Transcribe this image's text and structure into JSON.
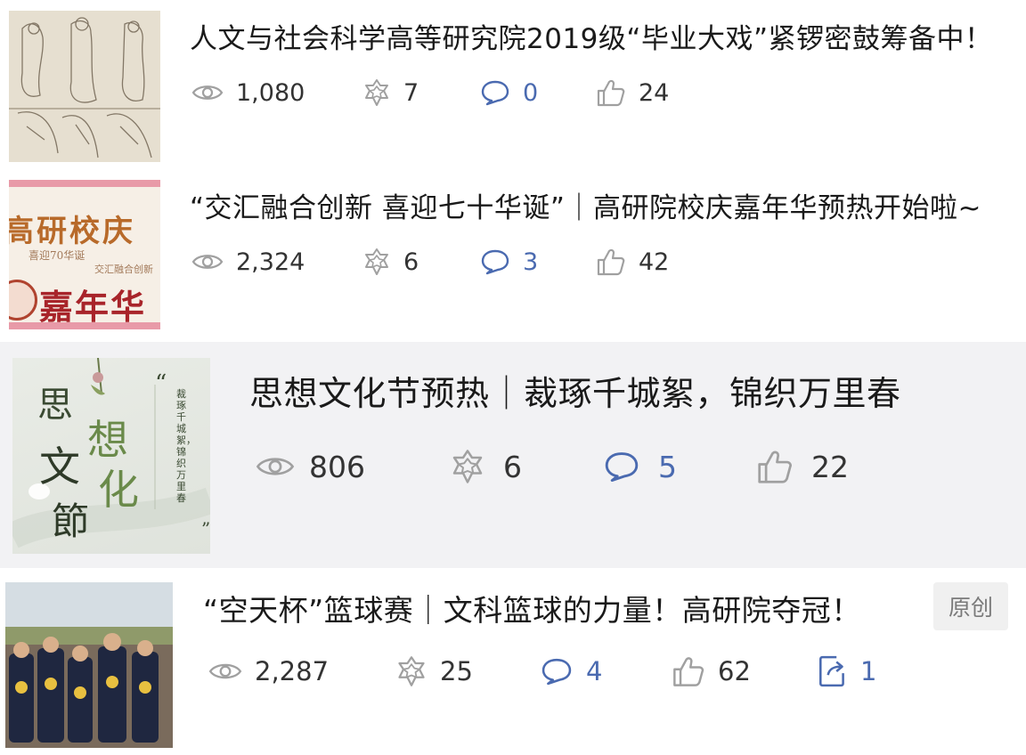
{
  "articles": [
    {
      "title": "人文与社会科学高等研究院2019级“毕业大戏”紧锣密鼓筹备中！",
      "views": "1,080",
      "stars": "7",
      "comments": "0",
      "likes": "24"
    },
    {
      "title": "“交汇融合创新 喜迎七十华诞”｜高研院校庆嘉年华预热开始啦~",
      "views": "2,324",
      "stars": "6",
      "comments": "3",
      "likes": "42",
      "thumb_text": {
        "line1": "高研校庆",
        "line2": "喜迎70华诞",
        "line3": "交汇融合创新",
        "line4": "嘉年华"
      }
    },
    {
      "title": "思想文化节预热｜裁琢千城絮，锦织万里春",
      "views": "806",
      "stars": "6",
      "comments": "5",
      "likes": "22",
      "thumb_text": {
        "big": [
          "思",
          "想",
          "文",
          "化",
          "節"
        ],
        "quote_open": "“",
        "quote_close": "”",
        "vertical": "裁琢千城絮，锦织万里春"
      }
    },
    {
      "title": "“空天杯”篮球赛｜文科篮球的力量！高研院夺冠！",
      "badge": "原创",
      "views": "2,287",
      "stars": "25",
      "comments": "4",
      "likes": "62",
      "shares": "1"
    }
  ],
  "colors": {
    "accent_blue": "#4a6ab0",
    "icon_gray": "#9a9a9a",
    "highlight_bg": "#f2f2f4"
  },
  "icons": [
    "eye-icon",
    "star-icon",
    "comment-icon",
    "thumbs-up-icon",
    "share-icon"
  ]
}
